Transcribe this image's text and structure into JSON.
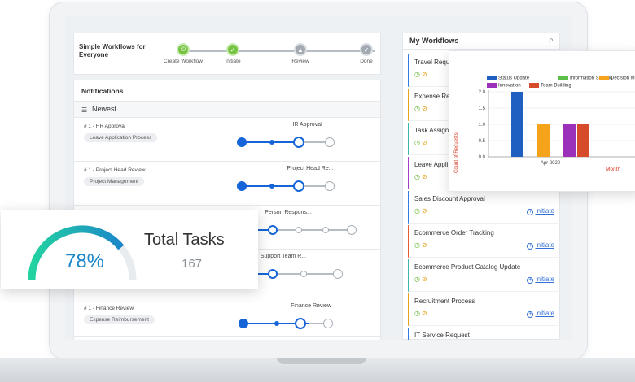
{
  "workflow_bar": {
    "title": "Simple Workflows for Everyone",
    "steps": [
      {
        "label": "Create Workflow",
        "state": "done"
      },
      {
        "label": "Initiate",
        "state": "done"
      },
      {
        "label": "Review",
        "state": "pending"
      },
      {
        "label": "Done",
        "state": "pending"
      }
    ]
  },
  "notifications": {
    "title": "Notifications",
    "filter_label": "Newest",
    "filter_icon": "sort-icon",
    "rows": [
      {
        "id": "# 1 - HR Approval",
        "tag": "Leave Application Process",
        "step": "HR Approval"
      },
      {
        "id": "# 1 - Project Head Review",
        "tag": "Project Management",
        "step": "Project Head Re..."
      },
      {
        "id": "",
        "tag": "",
        "step": "Person Respons..."
      },
      {
        "id": "",
        "tag": "",
        "step": "Support Team R..."
      },
      {
        "id": "# 1 - Finance Review",
        "tag": "Expense Reimbursement",
        "step": "Finance Review"
      }
    ]
  },
  "my_workflows": {
    "title": "My Workflows",
    "search_icon": "search-icon",
    "initiate_label": "Initiate",
    "items": [
      {
        "title": "Travel Requ",
        "accent": "#2f7de1",
        "initiate": false
      },
      {
        "title": "Expense Re",
        "accent": "#e6a21a",
        "initiate": false
      },
      {
        "title": "Task Assign",
        "accent": "#3cb6a8",
        "initiate": false
      },
      {
        "title": "Leave Appli",
        "accent": "#a33ec9",
        "initiate": false
      },
      {
        "title": "Sales Discount Approval",
        "accent": "#2f7de1",
        "initiate": true
      },
      {
        "title": "Ecommerce Order Tracking",
        "accent": "#e85a32",
        "initiate": true
      },
      {
        "title": "Ecommerce Product Catalog Update",
        "accent": "#3cb6a8",
        "initiate": true
      },
      {
        "title": "Recruitment Process",
        "accent": "#e6a21a",
        "initiate": true
      },
      {
        "title": "IT Service Request",
        "accent": "#2f7de1",
        "initiate": false
      }
    ]
  },
  "chart_data": {
    "type": "bar",
    "categories": [
      "Apr 2020"
    ],
    "series": [
      {
        "name": "Status Update",
        "color": "#1f5fc2",
        "values": [
          2.0
        ]
      },
      {
        "name": "Information Sharing",
        "color": "#5cbf4a",
        "values": [
          0
        ]
      },
      {
        "name": "Decision Ma",
        "color": "#f5a31a",
        "values": [
          1.0
        ]
      },
      {
        "name": "Innovation",
        "color": "#9b31b8",
        "values": [
          1.0
        ]
      },
      {
        "name": "Team Building",
        "color": "#d64b2a",
        "values": [
          1.0
        ]
      }
    ],
    "ylabel": "Count of Requests",
    "xlabel": "Month",
    "ylim": [
      0,
      2.0
    ],
    "yticks": [
      "0.0",
      "0.5",
      "1.0",
      "1.5",
      "2.0"
    ],
    "legend": "top"
  },
  "gauge": {
    "value_label": "78%",
    "fraction": 0.78,
    "title": "Total Tasks",
    "count": "167",
    "colors": [
      "#23d3a1",
      "#1b87c9"
    ]
  }
}
